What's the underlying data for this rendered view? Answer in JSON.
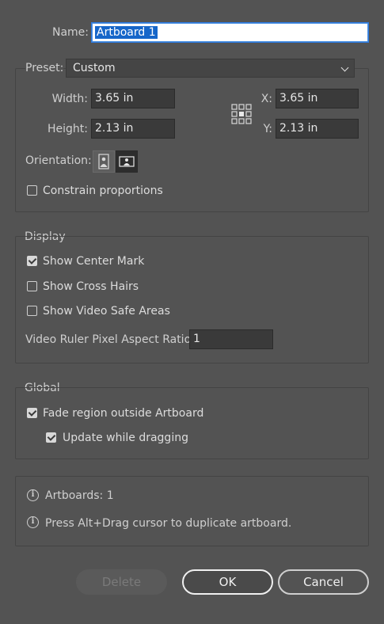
{
  "name": {
    "label": "Name:",
    "value": "Artboard 1"
  },
  "preset": {
    "label": "Preset:",
    "value": "Custom"
  },
  "size": {
    "width_label": "Width:",
    "width_value": "3.65 in",
    "height_label": "Height:",
    "height_value": "2.13 in",
    "x_label": "X:",
    "x_value": "3.65 in",
    "y_label": "Y:",
    "y_value": "2.13 in"
  },
  "orientation": {
    "label": "Orientation:",
    "selected": "landscape"
  },
  "constrain": {
    "label": "Constrain proportions",
    "checked": false
  },
  "display": {
    "title": "Display",
    "show_center_mark": {
      "label": "Show Center Mark",
      "checked": true
    },
    "show_cross_hairs": {
      "label": "Show Cross Hairs",
      "checked": false
    },
    "show_video_safe": {
      "label": "Show Video Safe Areas",
      "checked": false
    },
    "ratio_label": "Video Ruler Pixel Aspect Ratio:",
    "ratio_value": "1"
  },
  "global": {
    "title": "Global",
    "fade_region": {
      "label": "Fade region outside Artboard",
      "checked": true
    },
    "update_dragging": {
      "label": "Update while dragging",
      "checked": true
    }
  },
  "info": {
    "artboards": "Artboards: 1",
    "hint": "Press Alt+Drag cursor to duplicate artboard."
  },
  "buttons": {
    "delete": "Delete",
    "ok": "OK",
    "cancel": "Cancel"
  },
  "colors": {
    "background": "#535353",
    "selection": "#1666c9"
  }
}
